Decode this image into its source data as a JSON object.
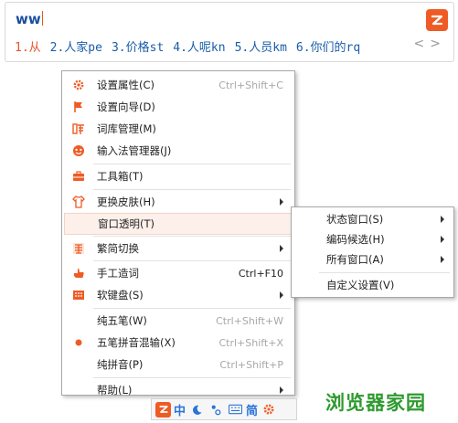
{
  "ime": {
    "composition": "ww",
    "candidates": [
      "1.从",
      "2.人家pe",
      "3.价格st",
      "4.人呢kn",
      "5.人员km",
      "6.你们的rq"
    ],
    "pager": "<>"
  },
  "menu": {
    "items": [
      {
        "label": "设置属性(C)",
        "shortcut": "Ctrl+Shift+C",
        "icon": "gear-icon"
      },
      {
        "label": "设置向导(D)",
        "shortcut": "",
        "icon": "flag-icon"
      },
      {
        "label": "词库管理(M)",
        "shortcut": "",
        "icon": "dictionary-icon"
      },
      {
        "label": "输入法管理器(J)",
        "shortcut": "",
        "icon": "manager-icon"
      },
      {
        "label": "工具箱(T)",
        "shortcut": "",
        "icon": "toolbox-icon"
      },
      {
        "label": "更换皮肤(H)",
        "shortcut": "",
        "icon": "shirt-icon"
      },
      {
        "label": "窗口透明(T)",
        "shortcut": "",
        "icon": ""
      },
      {
        "label": "繁简切换",
        "shortcut": "",
        "icon": "traditional-icon"
      },
      {
        "label": "手工造词",
        "shortcut": "Ctrl+F10",
        "icon": "hand-icon"
      },
      {
        "label": "软键盘(S)",
        "shortcut": "",
        "icon": "keyboard-icon"
      },
      {
        "label": "纯五笔(W)",
        "shortcut": "Ctrl+Shift+W",
        "icon": ""
      },
      {
        "label": "五笔拼音混输(X)",
        "shortcut": "Ctrl+Shift+X",
        "icon": "radio-dot-icon"
      },
      {
        "label": "纯拼音(P)",
        "shortcut": "Ctrl+Shift+P",
        "icon": ""
      },
      {
        "label": "帮助(L)",
        "shortcut": "",
        "icon": ""
      }
    ]
  },
  "submenu": {
    "items": [
      {
        "label": "状态窗口(S)"
      },
      {
        "label": "编码候选(H)"
      },
      {
        "label": "所有窗口(A)"
      },
      {
        "label": "自定义设置(V)"
      }
    ]
  },
  "status_bar": {
    "mode_text": "中",
    "script_text": "简"
  },
  "watermark": "浏览器家园",
  "colors": {
    "brand": "#ef5b25",
    "candidate": "#1a5da8",
    "first_candidate": "#e8552a",
    "status_text": "#2a73d9"
  }
}
